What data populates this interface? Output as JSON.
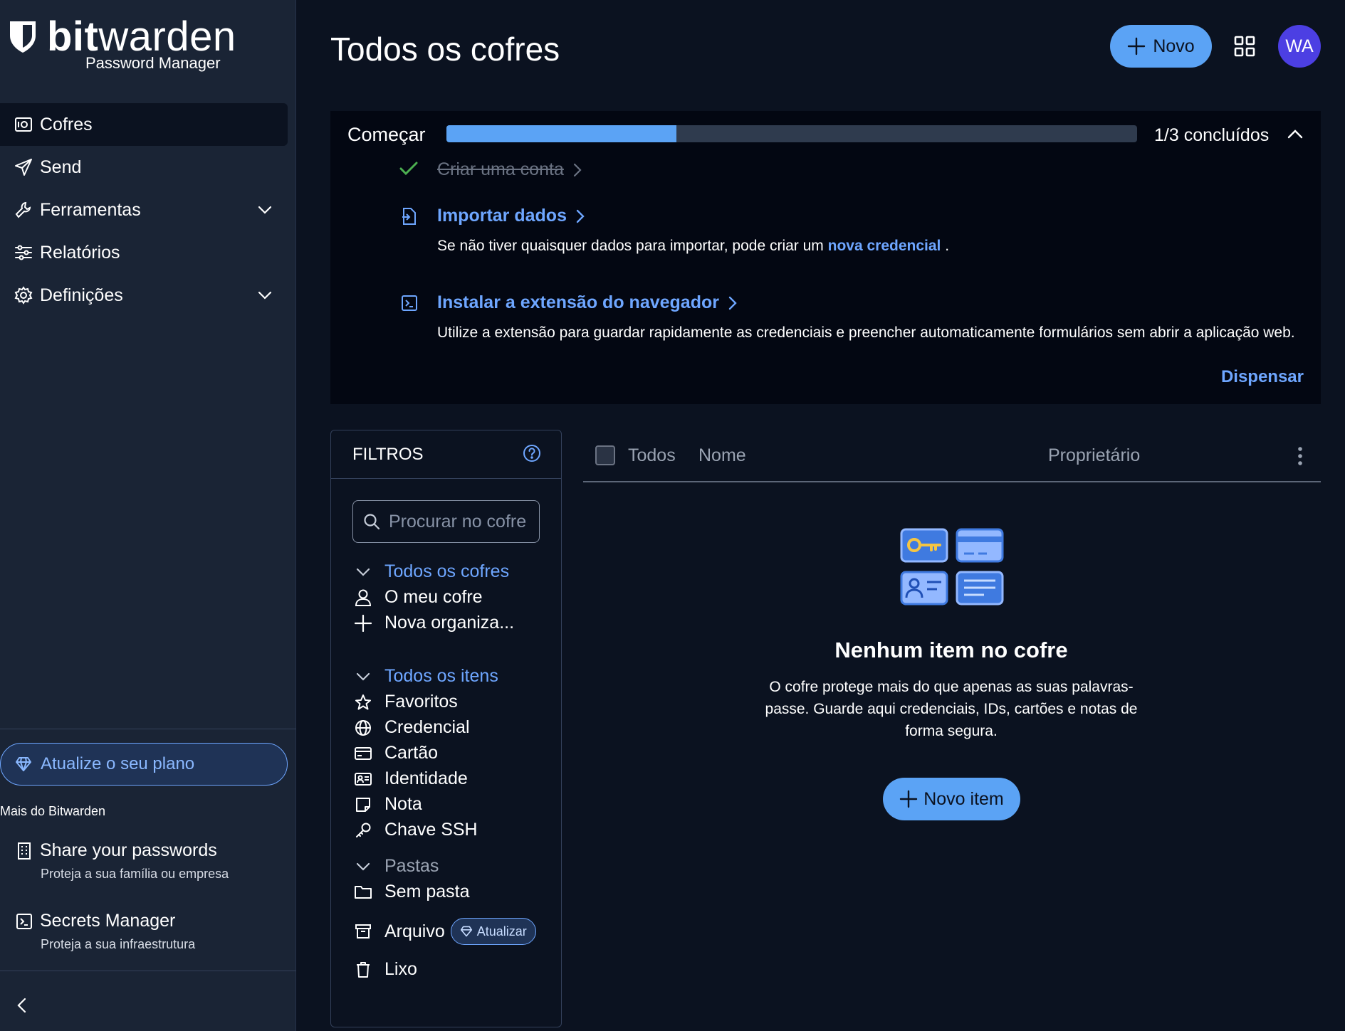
{
  "brand": {
    "name_bold": "bit",
    "name_light": "warden",
    "subtitle": "Password Manager"
  },
  "sidebar": {
    "items": [
      {
        "label": "Cofres",
        "icon": "vault-icon",
        "active": true
      },
      {
        "label": "Send",
        "icon": "send-icon"
      },
      {
        "label": "Ferramentas",
        "icon": "wrench-icon",
        "expandable": true
      },
      {
        "label": "Relatórios",
        "icon": "sliders-icon"
      },
      {
        "label": "Definições",
        "icon": "gear-icon",
        "expandable": true
      }
    ],
    "upgrade_label": "Atualize o seu plano",
    "more_title": "Mais do Bitwarden",
    "promos": [
      {
        "title": "Share your passwords",
        "subtitle": "Proteja a sua família ou empresa",
        "icon": "building-icon"
      },
      {
        "title": "Secrets Manager",
        "subtitle": "Proteja a sua infraestrutura",
        "icon": "terminal-icon"
      }
    ]
  },
  "header": {
    "title": "Todos os cofres",
    "new_label": "Novo",
    "avatar_initials": "WA"
  },
  "getting_started": {
    "title": "Começar",
    "progress": 0.333,
    "progress_text": "1/3 concluídos",
    "steps": [
      {
        "label": "Criar uma conta",
        "done": true
      },
      {
        "label": "Importar dados",
        "desc_prefix": "Se não tiver quaisquer dados para importar, pode criar um ",
        "desc_link": "nova credencial",
        "desc_suffix": " ."
      },
      {
        "label": "Instalar a extensão do navegador",
        "desc": "Utilize a extensão para guardar rapidamente as credenciais e preencher automaticamente formulários sem abrir a aplicação web."
      }
    ],
    "dismiss_label": "Dispensar"
  },
  "filters": {
    "title": "FILTROS",
    "search_placeholder": "Procurar no cofre",
    "vaults_header": "Todos os cofres",
    "vaults": [
      {
        "label": "O meu cofre",
        "icon": "user-icon"
      },
      {
        "label": "Nova organiza...",
        "icon": "plus-icon"
      }
    ],
    "items_header": "Todos os itens",
    "types": [
      {
        "label": "Favoritos",
        "icon": "star-icon"
      },
      {
        "label": "Credencial",
        "icon": "globe-icon"
      },
      {
        "label": "Cartão",
        "icon": "card-icon"
      },
      {
        "label": "Identidade",
        "icon": "id-card-icon"
      },
      {
        "label": "Nota",
        "icon": "note-icon"
      },
      {
        "label": "Chave SSH",
        "icon": "key-icon"
      }
    ],
    "folders_header": "Pastas",
    "folders": [
      {
        "label": "Sem pasta",
        "icon": "folder-icon"
      }
    ],
    "archive_label": "Arquivo",
    "archive_badge": "Atualizar",
    "trash_label": "Lixo"
  },
  "table": {
    "col_all": "Todos",
    "col_name": "Nome",
    "col_owner": "Proprietário"
  },
  "empty": {
    "title": "Nenhum item no cofre",
    "desc": "O cofre protege mais do que apenas as suas palavras-passe. Guarde aqui credenciais, IDs, cartões e notas de forma segura.",
    "button_label": "Novo item"
  },
  "colors": {
    "accent": "#5ba3f5",
    "link": "#6ea6ff",
    "sidebar_bg": "#1a2435",
    "page_bg": "#0b1220",
    "avatar_bg": "#4c3fe3",
    "success": "#4caf50"
  }
}
